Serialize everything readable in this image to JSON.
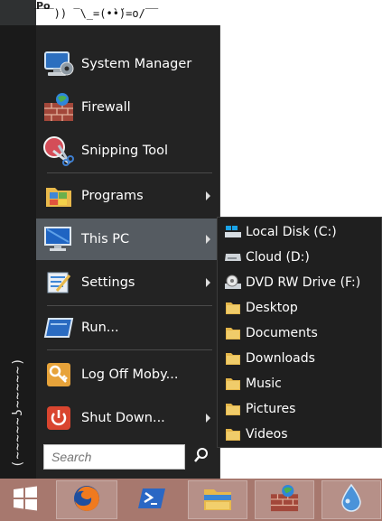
{
  "background": {
    "post_label": "Po",
    "ascii_text": "‾‾‾)) ‾\\_=(•̀•́)=o/‾‾"
  },
  "strip": {
    "text": "(~~~~~ʖ~~~~~)"
  },
  "menu": {
    "items": [
      {
        "label": "System Manager",
        "icon": "system-manager-icon",
        "has_submenu": false
      },
      {
        "label": "Firewall",
        "icon": "firewall-icon",
        "has_submenu": false
      },
      {
        "label": "Snipping Tool",
        "icon": "scissors-icon",
        "has_submenu": false
      },
      {
        "label": "Programs",
        "icon": "programs-folder-icon",
        "has_submenu": true
      },
      {
        "label": "This PC",
        "icon": "computer-icon",
        "has_submenu": true
      },
      {
        "label": "Settings",
        "icon": "settings-icon",
        "has_submenu": true
      },
      {
        "label": "Run...",
        "icon": "run-icon",
        "has_submenu": false
      },
      {
        "label": "Log Off Moby...",
        "icon": "key-icon",
        "has_submenu": false
      },
      {
        "label": "Shut Down...",
        "icon": "power-icon",
        "has_submenu": true
      }
    ],
    "active_item": "This PC"
  },
  "search": {
    "placeholder": "Search",
    "icon": "search-icon"
  },
  "submenu": {
    "items": [
      {
        "label": "Local Disk (C:)",
        "icon": "local-disk-icon"
      },
      {
        "label": "Cloud (D:)",
        "icon": "drive-icon"
      },
      {
        "label": "DVD RW Drive (F:)",
        "icon": "dvd-drive-icon"
      },
      {
        "label": "Desktop",
        "icon": "folder-icon"
      },
      {
        "label": "Documents",
        "icon": "folder-icon"
      },
      {
        "label": "Downloads",
        "icon": "folder-icon"
      },
      {
        "label": "Music",
        "icon": "folder-icon"
      },
      {
        "label": "Pictures",
        "icon": "folder-icon"
      },
      {
        "label": "Videos",
        "icon": "folder-icon"
      }
    ]
  },
  "taskbar": {
    "color": "#a7786e",
    "buttons": [
      {
        "name": "start-button",
        "icon": "windows-logo-icon"
      },
      {
        "name": "firefox-button",
        "icon": "firefox-icon"
      },
      {
        "name": "powershell-button",
        "icon": "powershell-icon"
      },
      {
        "name": "file-explorer-button",
        "icon": "file-explorer-icon"
      },
      {
        "name": "firewall-button",
        "icon": "firewall-icon"
      },
      {
        "name": "drop-app-button",
        "icon": "water-drop-icon"
      }
    ]
  }
}
